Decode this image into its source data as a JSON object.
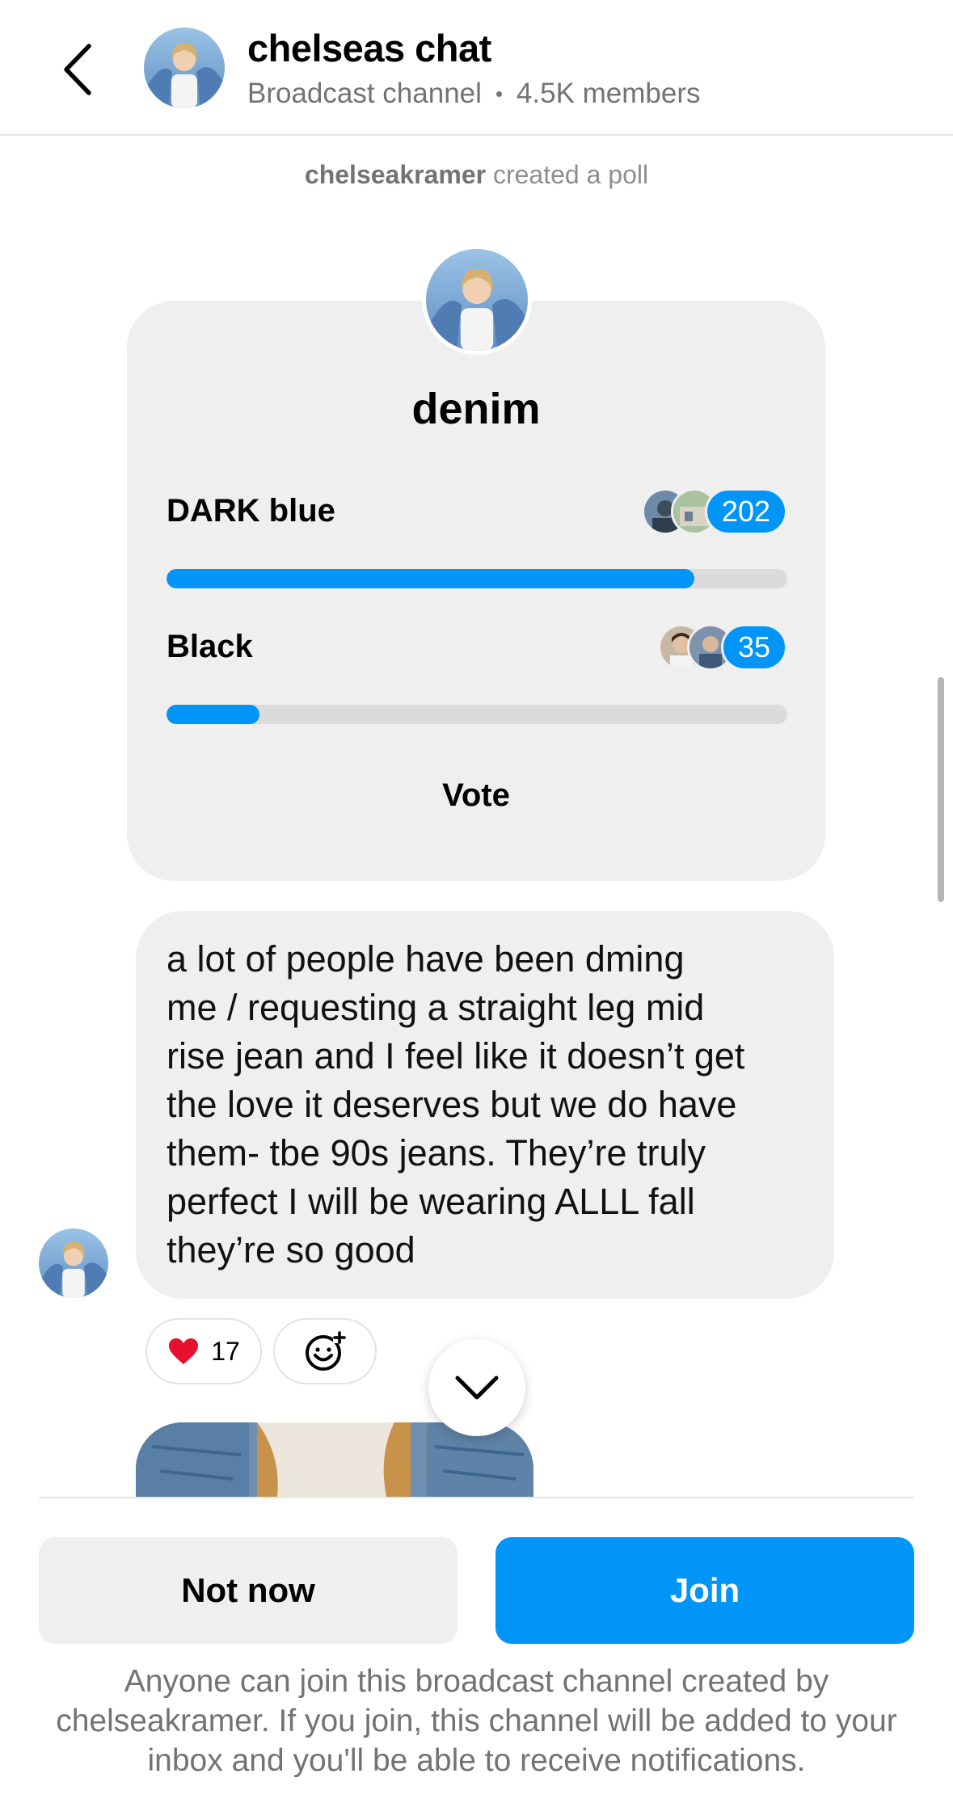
{
  "header": {
    "title": "chelseas chat",
    "subtitle_type": "Broadcast channel",
    "subtitle_members": "4.5K members"
  },
  "system_message": {
    "user": "chelseakramer",
    "action": "created a poll"
  },
  "poll": {
    "question": "denim",
    "options": [
      {
        "label": "DARK blue",
        "votes": "202",
        "fraction": 0.85
      },
      {
        "label": "Black",
        "votes": "35",
        "fraction": 0.15
      }
    ],
    "vote_label": "Vote"
  },
  "message": {
    "text": "a lot of people have been dming\nme / requesting a straight leg mid\nrise jean and I feel like it doesn’t get\nthe love it deserves but we do have\nthem- tbe 90s jeans. They’re truly\nperfect I will be wearing ALLL fall\nthey’re so good"
  },
  "reactions": {
    "heart_count": "17"
  },
  "footer": {
    "not_now_label": "Not now",
    "join_label": "Join",
    "note": "Anyone can join this broadcast channel created by chelseakramer. If you join, this channel will be added to your inbox and you'll be able to receive notifications."
  },
  "colors": {
    "accent": "#0095f6",
    "bubble": "#efefef",
    "muted_text": "#737373",
    "heart": "#e8102e"
  },
  "icons": [
    "chevron-left-icon",
    "heart-icon",
    "add-reaction-icon",
    "chevron-down-icon"
  ]
}
